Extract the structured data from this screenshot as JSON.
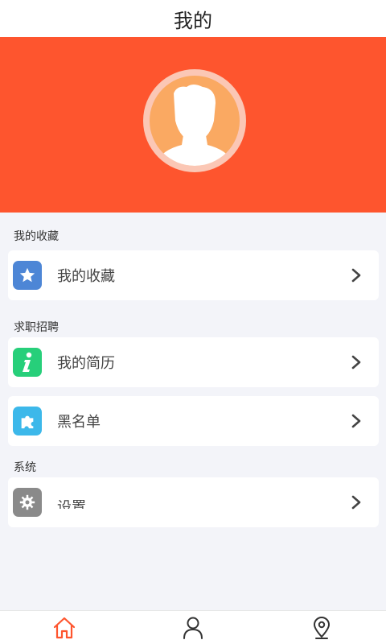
{
  "header": {
    "title": "我的"
  },
  "sections": {
    "favorites": {
      "label": "我的收藏"
    },
    "jobs": {
      "label": "求职招聘"
    },
    "system": {
      "label": "系统"
    }
  },
  "rows": {
    "favorites": {
      "label": "我的收藏",
      "icon": "star-icon",
      "color": "#4d86d6"
    },
    "resume": {
      "label": "我的简历",
      "icon": "info-icon",
      "color": "#27cf7a"
    },
    "blacklist": {
      "label": "黑名单",
      "icon": "puzzle-icon",
      "color": "#3cb8ea"
    },
    "settings": {
      "label": "设置",
      "icon": "gear-icon",
      "color": "#8a8a8a"
    }
  },
  "tabbar": {
    "items": [
      {
        "icon": "home-icon",
        "active": true,
        "color": "#fe552e"
      },
      {
        "icon": "person-icon",
        "active": false
      },
      {
        "icon": "location-pin-icon",
        "active": false
      }
    ]
  },
  "colors": {
    "accent": "#fe552e",
    "background": "#f3f4f9"
  }
}
